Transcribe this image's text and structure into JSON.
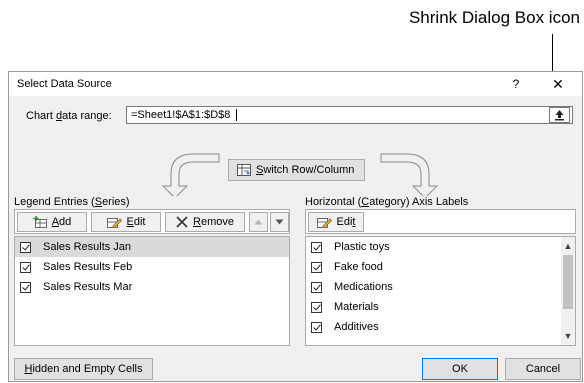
{
  "callout": {
    "text": "Shrink Dialog Box icon"
  },
  "dialog": {
    "title": "Select Data Source",
    "help_glyph": "?",
    "close_glyph": "✕",
    "range": {
      "label_pre": "Chart ",
      "label_u": "d",
      "label_post": "ata range:",
      "value": "=Sheet1!$A$1:$D$8"
    },
    "switch": {
      "pre": "",
      "u": "S",
      "post": "witch Row/Column"
    },
    "legend": {
      "label_pre": "Legend Entries (",
      "label_u": "S",
      "label_post": "eries)",
      "add": {
        "u": "A",
        "post": "dd"
      },
      "edit": {
        "u": "E",
        "post": "dit"
      },
      "remove": {
        "u": "R",
        "post": "emove"
      },
      "items": [
        {
          "label": "Sales Results  Jan",
          "checked": true,
          "selected": true
        },
        {
          "label": "Sales Results  Feb",
          "checked": true,
          "selected": false
        },
        {
          "label": "Sales Results  Mar",
          "checked": true,
          "selected": false
        }
      ]
    },
    "axis": {
      "label_pre": "Horizontal (",
      "label_u": "C",
      "label_post": "ategory) Axis Labels",
      "edit": {
        "pre": "Edi",
        "u": "t"
      },
      "items": [
        {
          "label": "Plastic toys",
          "checked": true
        },
        {
          "label": "Fake food",
          "checked": true
        },
        {
          "label": "Medications",
          "checked": true
        },
        {
          "label": "Materials",
          "checked": true
        },
        {
          "label": "Additives",
          "checked": true
        }
      ]
    },
    "hidden_cells": {
      "u": "H",
      "post": "idden and Empty Cells"
    },
    "ok": "OK",
    "cancel": "Cancel"
  }
}
